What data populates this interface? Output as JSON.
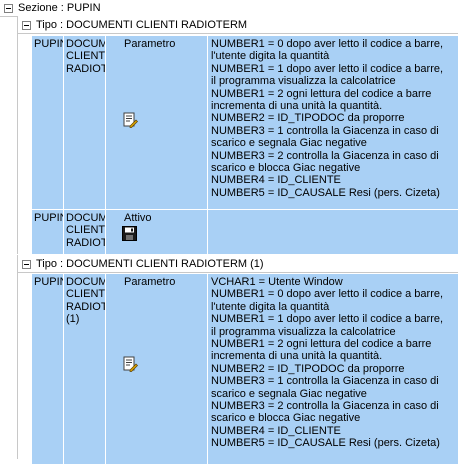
{
  "section": {
    "label": "Sezione : PUPIN"
  },
  "groups": [
    {
      "label": "Tipo : DOCUMENTI CLIENTI RADIOTERM",
      "rows": [
        {
          "col1": "PUPIN",
          "col2": [
            "DOCUMI",
            "CLIENTI",
            "RADIOT"
          ],
          "col3": "Parametro",
          "icon": "text-edit-icon",
          "desc": [
            "NUMBER1 = 0 dopo aver letto il codice a barre,",
            "l'utente digita la quantità",
            "NUMBER1 = 1 dopo aver letto il codice a barre,",
            "il programma visualizza la calcolatrice",
            "NUMBER1 = 2 ogni lettura del codice a barre",
            "incrementa di una unità la quantità.",
            "NUMBER2 = ID_TIPODOC da proporre",
            "NUMBER3 = 1 controlla la Giacenza in caso di",
            "scarico e segnala Giac negative",
            "NUMBER3 = 2 controlla la Giacenza in caso di",
            "scarico e blocca  Giac negative",
            "NUMBER4 = ID_CLIENTE",
            "NUMBER5 = ID_CAUSALE Resi (pers. Cizeta)"
          ]
        },
        {
          "col1": "PUPIN",
          "col2": [
            "DOCUMI",
            "CLIENTI",
            "RADIOT"
          ],
          "col3": "Attivo",
          "icon": "floppy-disk-icon",
          "desc": []
        }
      ]
    },
    {
      "label": "Tipo : DOCUMENTI CLIENTI RADIOTERM (1)",
      "rows": [
        {
          "col1": "PUPIN",
          "col2": [
            "DOCUMI",
            "CLIENTI",
            "RADIOT",
            "(1)"
          ],
          "col3": "Parametro",
          "icon": "text-edit-icon",
          "desc": [
            "VCHAR1 = Utente Window",
            "NUMBER1 = 0 dopo aver letto il codice a barre,",
            "l'utente digita la quantità",
            "NUMBER1 = 1 dopo aver letto il codice a barre,",
            "il programma visualizza la calcolatrice",
            "NUMBER1 = 2 ogni lettura del codice a barre",
            "incrementa di una unità la quantità.",
            "NUMBER2 = ID_TIPODOC da proporre",
            "NUMBER3 = 1 controlla la Giacenza in caso di",
            "scarico e segnala Giac negative",
            "NUMBER3 = 2 controlla la Giacenza in caso di",
            "scarico e blocca  Giac negative",
            "NUMBER4 = ID_CLIENTE",
            "NUMBER5 = ID_CAUSALE Resi (pers. Cizeta)"
          ]
        }
      ]
    }
  ]
}
